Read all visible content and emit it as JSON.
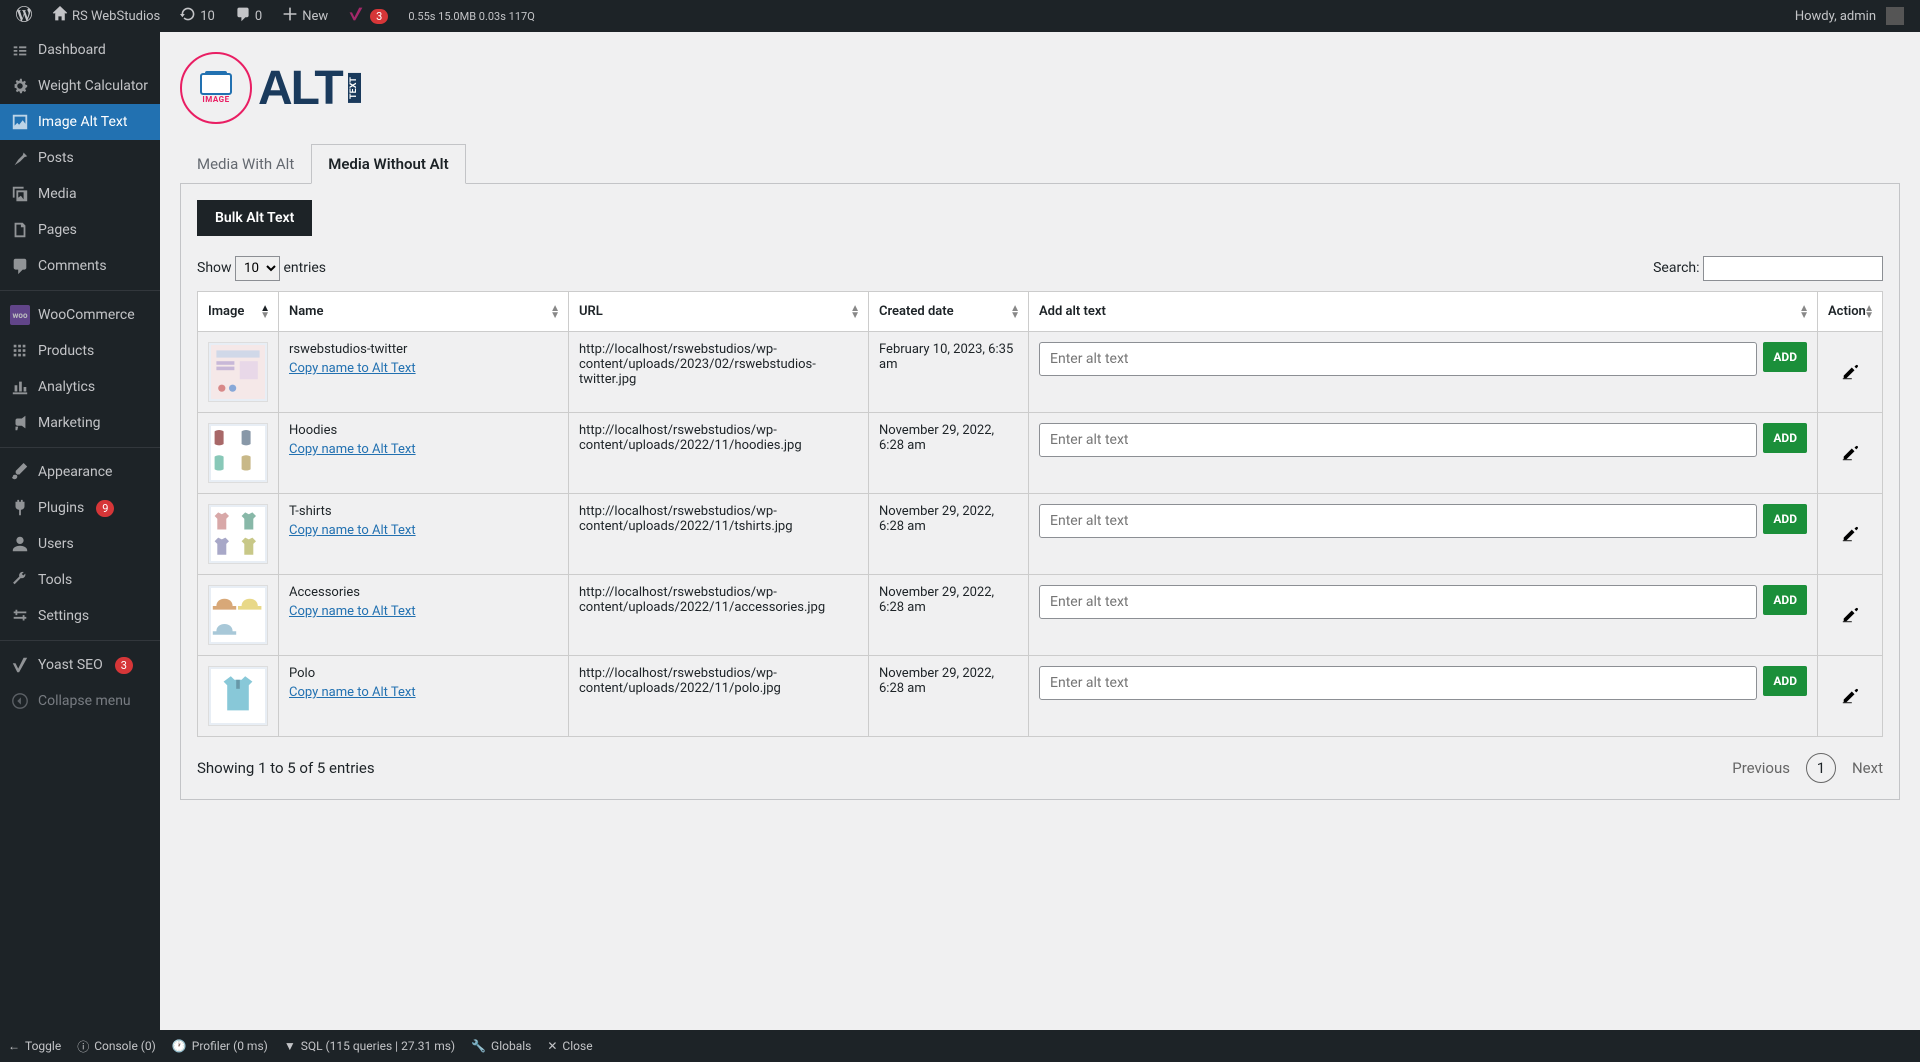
{
  "adminbar": {
    "site": "RS WebStudios",
    "updates": "10",
    "comments": "0",
    "new": "New",
    "yoast_count": "3",
    "stats": "0.55s 15.0MB 0.03s 117Q",
    "howdy": "Howdy, admin"
  },
  "sidebar": {
    "dashboard": "Dashboard",
    "weight_calc": "Weight Calculator",
    "image_alt": "Image Alt Text",
    "posts": "Posts",
    "media": "Media",
    "pages": "Pages",
    "comments": "Comments",
    "woocommerce": "WooCommerce",
    "products": "Products",
    "analytics": "Analytics",
    "marketing": "Marketing",
    "appearance": "Appearance",
    "plugins": "Plugins",
    "plugins_count": "9",
    "users": "Users",
    "tools": "Tools",
    "settings": "Settings",
    "yoast": "Yoast SEO",
    "yoast_count": "3",
    "collapse": "Collapse menu"
  },
  "logo": {
    "image_text": "IMAGE",
    "alt_text": "ALT",
    "text_box": "TEXT"
  },
  "tabs": {
    "with_alt": "Media With Alt",
    "without_alt": "Media Without Alt"
  },
  "bulk_button": "Bulk Alt Text",
  "dt": {
    "show": "Show",
    "entries": "entries",
    "length_options": [
      "10"
    ],
    "length_value": "10",
    "search_label": "Search:"
  },
  "columns": {
    "image": "Image",
    "name": "Name",
    "url": "URL",
    "created": "Created date",
    "alt": "Add alt text",
    "action": "Action"
  },
  "copy_link": "Copy name to Alt Text",
  "alt_placeholder": "Enter alt text",
  "add_button": "ADD",
  "rows": [
    {
      "name": "rswebstudios-twitter",
      "url": "http://localhost/rswebstudios/wp-content/uploads/2023/02/rswebstudios-twitter.jpg",
      "created": "February 10, 2023, 6:35 am",
      "thumb_type": "twitter"
    },
    {
      "name": "Hoodies",
      "url": "http://localhost/rswebstudios/wp-content/uploads/2022/11/hoodies.jpg",
      "created": "November 29, 2022, 6:28 am",
      "thumb_type": "hoodies"
    },
    {
      "name": "T-shirts",
      "url": "http://localhost/rswebstudios/wp-content/uploads/2022/11/tshirts.jpg",
      "created": "November 29, 2022, 6:28 am",
      "thumb_type": "tshirts"
    },
    {
      "name": "Accessories",
      "url": "http://localhost/rswebstudios/wp-content/uploads/2022/11/accessories.jpg",
      "created": "November 29, 2022, 6:28 am",
      "thumb_type": "accessories"
    },
    {
      "name": "Polo",
      "url": "http://localhost/rswebstudios/wp-content/uploads/2022/11/polo.jpg",
      "created": "November 29, 2022, 6:28 am",
      "thumb_type": "polo"
    }
  ],
  "footer": {
    "info": "Showing 1 to 5 of 5 entries",
    "prev": "Previous",
    "page": "1",
    "next": "Next"
  },
  "debugbar": {
    "toggle": "Toggle",
    "console": "Console (0)",
    "profiler": "Profiler (0 ms)",
    "sql": "SQL (115 queries | 27.31 ms)",
    "globals": "Globals",
    "close": "Close"
  }
}
